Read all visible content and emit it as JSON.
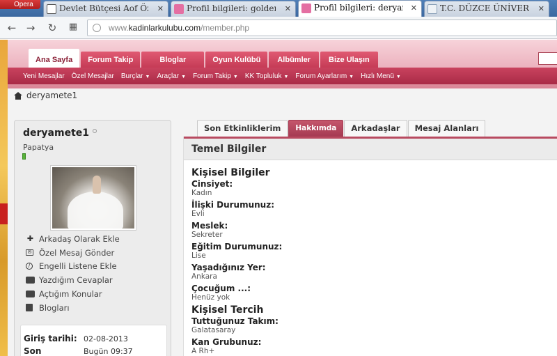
{
  "browser": {
    "menu_label": "Opera",
    "tabs": [
      {
        "title": "Devlet Bütçesi Aof Öze",
        "active": false
      },
      {
        "title": "Profil bilgileri: goldenro",
        "active": false
      },
      {
        "title": "Profil bilgileri: deryame",
        "active": true
      },
      {
        "title": "T.C. DÜZCE ÜNİVERSİ",
        "active": false
      }
    ],
    "url_prefix": "www.",
    "url_domain": "kadinlarkulubu.com",
    "url_path": "/member.php"
  },
  "site": {
    "main_nav": [
      "Ana Sayfa",
      "Forum Takip",
      "Bloglar",
      "Oyun Kulübü",
      "Albümler",
      "Bize Ulaşın"
    ],
    "sub_nav": [
      {
        "label": "Yeni Mesajlar",
        "dropdown": false
      },
      {
        "label": "Özel Mesajlar",
        "dropdown": false
      },
      {
        "label": "Burçlar",
        "dropdown": true
      },
      {
        "label": "Araçlar",
        "dropdown": true
      },
      {
        "label": "Forum Takip",
        "dropdown": true
      },
      {
        "label": "KK Topluluk",
        "dropdown": true
      },
      {
        "label": "Forum Ayarlarım",
        "dropdown": true
      },
      {
        "label": "Hızlı Menü",
        "dropdown": true
      }
    ],
    "caret": "▼"
  },
  "breadcrumb": {
    "username": "deryamete1"
  },
  "profile": {
    "username": "deryamete1",
    "user_title": "Papatya",
    "actions": [
      {
        "label": "Arkadaş Olarak Ekle",
        "icon": "plus-icon"
      },
      {
        "label": "Özel Mesaj Gönder",
        "icon": "envelope-icon"
      },
      {
        "label": "Engelli Listene Ekle",
        "icon": "block-icon"
      },
      {
        "label": "Yazdığım Cevaplar",
        "icon": "chat-icon"
      },
      {
        "label": "Açtığım Konular",
        "icon": "chat-icon"
      },
      {
        "label": "Blogları",
        "icon": "blog-icon"
      }
    ],
    "join_label": "Giriş tarihi:",
    "join_value": "02-08-2013",
    "last_label": "Son",
    "last_value": "Bugün 09:37"
  },
  "profile_tabs": [
    "Son Etkinliklerim",
    "Hakkımda",
    "Arkadaşlar",
    "Mesaj Alanları"
  ],
  "section": {
    "title": "Temel Bilgiler",
    "groups": [
      {
        "title": "Kişisel Bilgiler",
        "fields": [
          {
            "label": "Cinsiyet:",
            "value": "Kadın"
          },
          {
            "label": "İlişki Durumunuz:",
            "value": "Evli"
          },
          {
            "label": "Meslek:",
            "value": "Sekreter"
          },
          {
            "label": "Eğitim Durumunuz:",
            "value": "Lise"
          },
          {
            "label": "Yaşadığınız Yer:",
            "value": "Ankara"
          },
          {
            "label": "Çocuğum ...:",
            "value": "Henüz yok"
          }
        ]
      },
      {
        "title": "Kişisel Tercih",
        "fields": [
          {
            "label": "Tuttuğunuz Takım:",
            "value": "Galatasaray"
          },
          {
            "label": "Kan Grubunuz:",
            "value": "A Rh+"
          }
        ]
      }
    ]
  }
}
